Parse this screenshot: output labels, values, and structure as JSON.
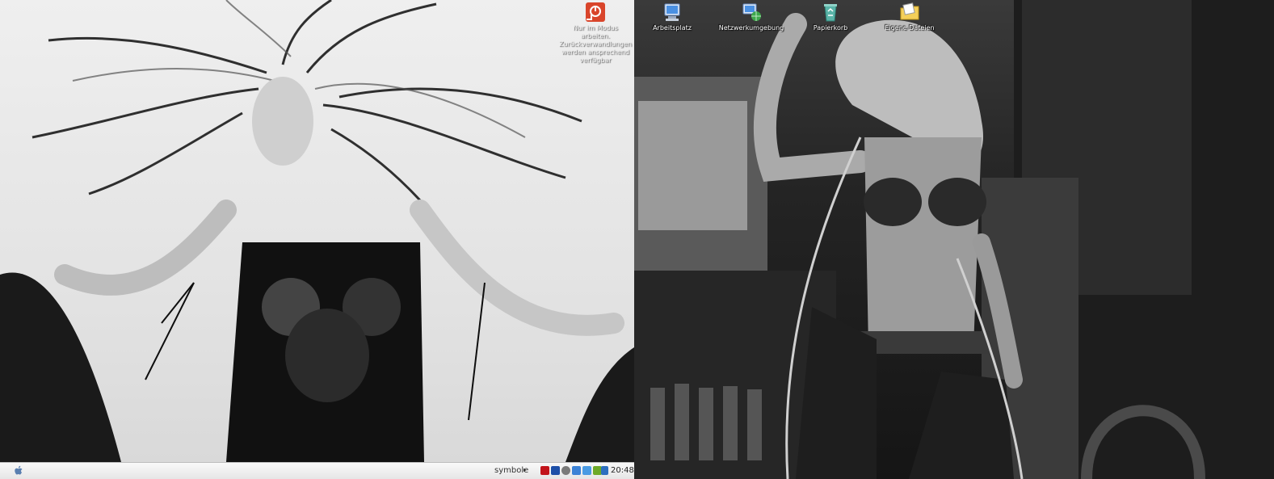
{
  "desktop_left": {
    "warning_icon": {
      "label": "Nur im Modus arbeiten. Zurückverwandlungen werden ansprechend verfügbar",
      "icon": "warning-icon"
    },
    "taskbar": {
      "symbols_label": "symbole",
      "arrow": "▸",
      "clock": "20:48",
      "tray_icons": [
        "kaspersky-icon",
        "flag-icon",
        "av-icon",
        "network-icon",
        "monitor-icon",
        "nvidia-icon",
        "display-icon"
      ]
    }
  },
  "desktop_right": {
    "icons": [
      {
        "label": "Arbeitsplatz",
        "icon": "computer-icon"
      },
      {
        "label": "Netzwerkumgebung",
        "icon": "network-places-icon"
      },
      {
        "label": "Papierkorb",
        "icon": "recycle-bin-icon"
      },
      {
        "label": "Eigene Dateien",
        "icon": "my-documents-icon"
      }
    ]
  },
  "colors": {
    "taskbar_bg": "#eeeeee",
    "icon_text": "#ffffff"
  }
}
